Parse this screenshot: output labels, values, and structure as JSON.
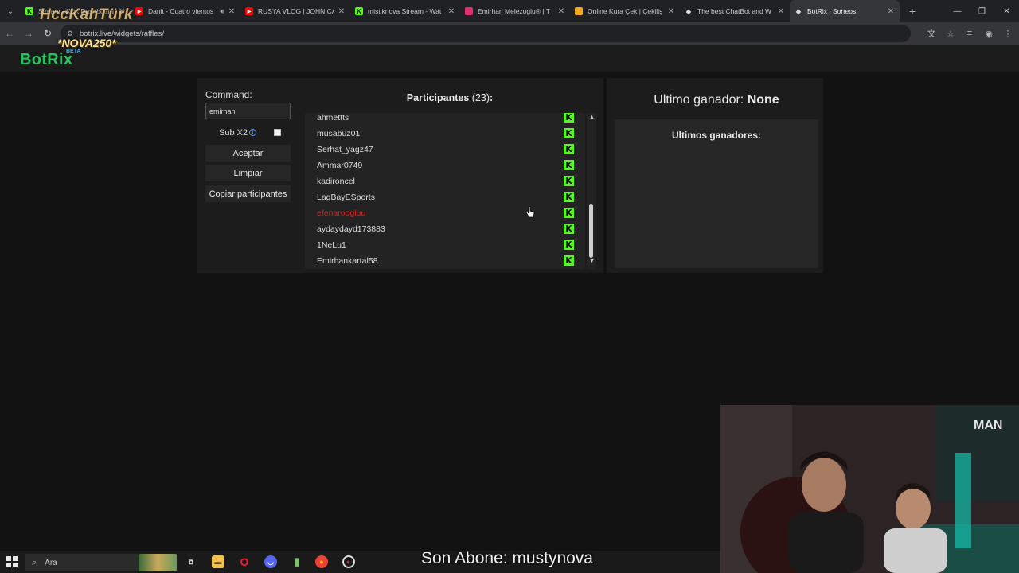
{
  "browser": {
    "tabs": [
      {
        "title": "Stream - Kick Dashboard",
        "icon": "kick-icon",
        "color": "#53fc18",
        "sound": false,
        "active": false
      },
      {
        "title": "Danit - Cuatro vientos",
        "icon": "youtube-icon",
        "color": "#ff0000",
        "sound": true,
        "active": false
      },
      {
        "title": "RUSYA VLOG | JOHN CAI",
        "icon": "youtube-icon",
        "color": "#ff0000",
        "sound": false,
        "active": false
      },
      {
        "title": "mistiknova Stream - Wat",
        "icon": "kick-icon",
        "color": "#53fc18",
        "sound": false,
        "active": false
      },
      {
        "title": "Emirhan Melezoglu® | T",
        "icon": "instagram-icon",
        "color": "#e1306c",
        "sound": false,
        "active": false
      },
      {
        "title": "Online Kura Çek | Çekiliş",
        "icon": "raffle-site-icon",
        "color": "#f5a623",
        "sound": false,
        "active": false
      },
      {
        "title": "The best ChatBot and W",
        "icon": "botrix-icon",
        "color": "#ffffff",
        "sound": false,
        "active": false
      },
      {
        "title": "BotRix | Sorteos",
        "icon": "botrix-icon",
        "color": "#ffffff",
        "sound": false,
        "active": true
      }
    ],
    "url": "botrix.live/widgets/raffles/"
  },
  "site": {
    "logo": "BotRix",
    "beta": "BETA"
  },
  "overlay": {
    "streamer_name": "HccKahTürk",
    "promo_code": "*NOVA250*",
    "last_sub_text": "Son Abone: mustynova"
  },
  "raffle": {
    "command_label": "Command:",
    "command_value": "emirhan",
    "sub_label": "Sub X2",
    "sub_checked": false,
    "accept_label": "Aceptar",
    "clear_label": "Limpiar",
    "copy_label": "Copiar participantes",
    "participants_title": "Participantes",
    "participants_count": "(23)",
    "participants_colon": ":",
    "participants": [
      {
        "name": "ahmettts",
        "winner": false
      },
      {
        "name": "musabuz01",
        "winner": false
      },
      {
        "name": "Serhat_yagz47",
        "winner": false
      },
      {
        "name": "Ammar0749",
        "winner": false
      },
      {
        "name": "kadironcel",
        "winner": false
      },
      {
        "name": "LagBayESports",
        "winner": false
      },
      {
        "name": "efenaroogluu",
        "winner": true
      },
      {
        "name": "aydaydayd173883",
        "winner": false
      },
      {
        "name": "1NeLu1",
        "winner": false
      },
      {
        "name": "Emirhankartal58",
        "winner": false
      }
    ],
    "last_winner_label": "Ultimo ganador:",
    "last_winner_value": "None",
    "winners_title": "Ultimos ganadores:"
  },
  "taskbar": {
    "search_placeholder": "Ara"
  }
}
